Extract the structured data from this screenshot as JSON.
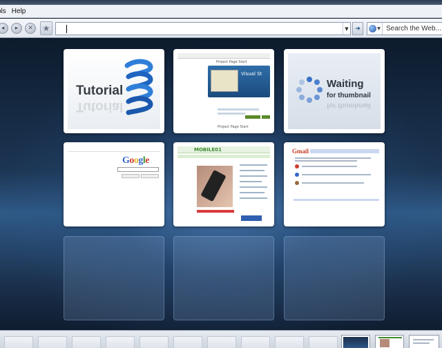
{
  "menu": {
    "items": [
      "ols",
      "Help"
    ]
  },
  "toolbar": {
    "back_icon": "back-arrow-icon",
    "forward_icon": "forward-arrow-icon",
    "stop_icon": "stop-icon",
    "url_value": "",
    "search_placeholder": "Search the Web..."
  },
  "speed_dial": {
    "tiles": [
      {
        "kind": "thumbnail",
        "caption": "Tutorial"
      },
      {
        "kind": "thumbnail",
        "breadcrumb": "Project Page Start",
        "hero_text": "Visual St",
        "footer": "Project Page Start"
      },
      {
        "kind": "placeholder",
        "line1": "Waiting",
        "line2": "for thumbnail"
      },
      {
        "kind": "thumbnail",
        "logo": "Google"
      },
      {
        "kind": "thumbnail",
        "logo": "MOBILE01"
      },
      {
        "kind": "thumbnail",
        "logo": "Gmail"
      },
      {
        "kind": "empty"
      },
      {
        "kind": "empty"
      },
      {
        "kind": "empty"
      }
    ]
  },
  "colors": {
    "accent": "#1e4f9c",
    "background_dark": "#0e1d2e",
    "google_blue": "#3366cc",
    "google_red": "#d03d2e",
    "google_yellow": "#e8b32a",
    "google_green": "#3a9a3a"
  }
}
